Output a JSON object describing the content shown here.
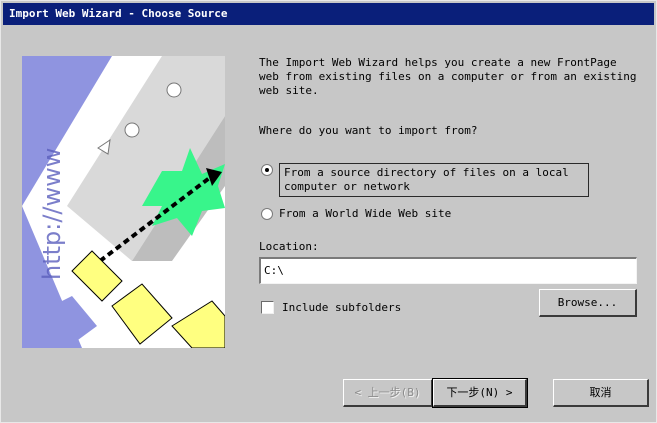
{
  "window": {
    "title": "Import Web Wizard - Choose Source"
  },
  "illustration": {
    "url_text": "http://www"
  },
  "intro": {
    "text": "The Import Web Wizard helps you create a new FrontPage web from existing files on a computer or from an existing web site."
  },
  "question": "Where do you want to import from?",
  "options": [
    {
      "label": "From a source directory of files on a local computer or network",
      "selected": true
    },
    {
      "label": "From a World Wide Web site",
      "selected": false
    }
  ],
  "location": {
    "label": "Location:",
    "value": "C:\\"
  },
  "subfolders": {
    "label": "Include subfolders",
    "checked": false
  },
  "buttons": {
    "browse": "Browse...",
    "back": "< 上一步(B)",
    "next": "下一步(N) >",
    "cancel": "取消"
  }
}
